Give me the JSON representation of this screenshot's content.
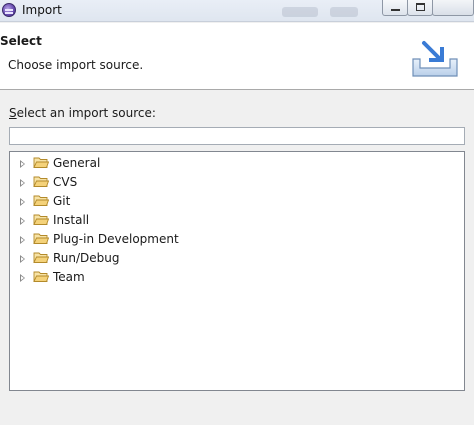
{
  "window": {
    "title": "Import"
  },
  "header": {
    "title": "Select",
    "description": "Choose import source."
  },
  "source": {
    "label_mnemonic": "S",
    "label_rest": "elect an import source:",
    "filter_value": "",
    "filter_placeholder": ""
  },
  "tree": {
    "items": [
      {
        "label": "General",
        "icon": "folder-icon"
      },
      {
        "label": "CVS",
        "icon": "folder-icon"
      },
      {
        "label": "Git",
        "icon": "folder-icon"
      },
      {
        "label": "Install",
        "icon": "folder-icon"
      },
      {
        "label": "Plug-in Development",
        "icon": "folder-icon"
      },
      {
        "label": "Run/Debug",
        "icon": "folder-icon"
      },
      {
        "label": "Team",
        "icon": "folder-icon"
      }
    ]
  },
  "colors": {
    "folder_fill": "#f4d27a",
    "folder_stroke": "#b38a2a",
    "banner_blue": "#3a7bd5"
  }
}
